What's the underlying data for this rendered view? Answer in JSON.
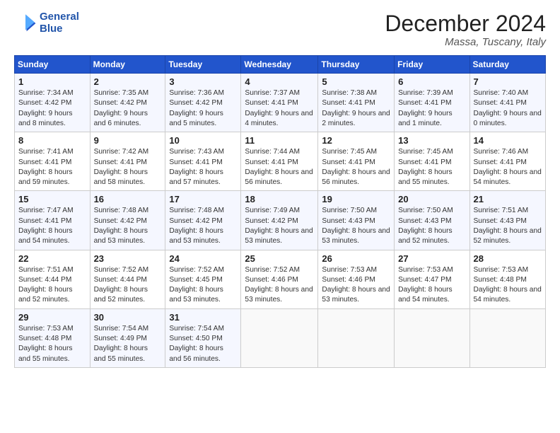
{
  "header": {
    "logo_line1": "General",
    "logo_line2": "Blue",
    "month": "December 2024",
    "location": "Massa, Tuscany, Italy"
  },
  "weekdays": [
    "Sunday",
    "Monday",
    "Tuesday",
    "Wednesday",
    "Thursday",
    "Friday",
    "Saturday"
  ],
  "weeks": [
    [
      {
        "day": "1",
        "sunrise": "Sunrise: 7:34 AM",
        "sunset": "Sunset: 4:42 PM",
        "daylight": "Daylight: 9 hours and 8 minutes."
      },
      {
        "day": "2",
        "sunrise": "Sunrise: 7:35 AM",
        "sunset": "Sunset: 4:42 PM",
        "daylight": "Daylight: 9 hours and 6 minutes."
      },
      {
        "day": "3",
        "sunrise": "Sunrise: 7:36 AM",
        "sunset": "Sunset: 4:42 PM",
        "daylight": "Daylight: 9 hours and 5 minutes."
      },
      {
        "day": "4",
        "sunrise": "Sunrise: 7:37 AM",
        "sunset": "Sunset: 4:41 PM",
        "daylight": "Daylight: 9 hours and 4 minutes."
      },
      {
        "day": "5",
        "sunrise": "Sunrise: 7:38 AM",
        "sunset": "Sunset: 4:41 PM",
        "daylight": "Daylight: 9 hours and 2 minutes."
      },
      {
        "day": "6",
        "sunrise": "Sunrise: 7:39 AM",
        "sunset": "Sunset: 4:41 PM",
        "daylight": "Daylight: 9 hours and 1 minute."
      },
      {
        "day": "7",
        "sunrise": "Sunrise: 7:40 AM",
        "sunset": "Sunset: 4:41 PM",
        "daylight": "Daylight: 9 hours and 0 minutes."
      }
    ],
    [
      {
        "day": "8",
        "sunrise": "Sunrise: 7:41 AM",
        "sunset": "Sunset: 4:41 PM",
        "daylight": "Daylight: 8 hours and 59 minutes."
      },
      {
        "day": "9",
        "sunrise": "Sunrise: 7:42 AM",
        "sunset": "Sunset: 4:41 PM",
        "daylight": "Daylight: 8 hours and 58 minutes."
      },
      {
        "day": "10",
        "sunrise": "Sunrise: 7:43 AM",
        "sunset": "Sunset: 4:41 PM",
        "daylight": "Daylight: 8 hours and 57 minutes."
      },
      {
        "day": "11",
        "sunrise": "Sunrise: 7:44 AM",
        "sunset": "Sunset: 4:41 PM",
        "daylight": "Daylight: 8 hours and 56 minutes."
      },
      {
        "day": "12",
        "sunrise": "Sunrise: 7:45 AM",
        "sunset": "Sunset: 4:41 PM",
        "daylight": "Daylight: 8 hours and 56 minutes."
      },
      {
        "day": "13",
        "sunrise": "Sunrise: 7:45 AM",
        "sunset": "Sunset: 4:41 PM",
        "daylight": "Daylight: 8 hours and 55 minutes."
      },
      {
        "day": "14",
        "sunrise": "Sunrise: 7:46 AM",
        "sunset": "Sunset: 4:41 PM",
        "daylight": "Daylight: 8 hours and 54 minutes."
      }
    ],
    [
      {
        "day": "15",
        "sunrise": "Sunrise: 7:47 AM",
        "sunset": "Sunset: 4:41 PM",
        "daylight": "Daylight: 8 hours and 54 minutes."
      },
      {
        "day": "16",
        "sunrise": "Sunrise: 7:48 AM",
        "sunset": "Sunset: 4:42 PM",
        "daylight": "Daylight: 8 hours and 53 minutes."
      },
      {
        "day": "17",
        "sunrise": "Sunrise: 7:48 AM",
        "sunset": "Sunset: 4:42 PM",
        "daylight": "Daylight: 8 hours and 53 minutes."
      },
      {
        "day": "18",
        "sunrise": "Sunrise: 7:49 AM",
        "sunset": "Sunset: 4:42 PM",
        "daylight": "Daylight: 8 hours and 53 minutes."
      },
      {
        "day": "19",
        "sunrise": "Sunrise: 7:50 AM",
        "sunset": "Sunset: 4:43 PM",
        "daylight": "Daylight: 8 hours and 53 minutes."
      },
      {
        "day": "20",
        "sunrise": "Sunrise: 7:50 AM",
        "sunset": "Sunset: 4:43 PM",
        "daylight": "Daylight: 8 hours and 52 minutes."
      },
      {
        "day": "21",
        "sunrise": "Sunrise: 7:51 AM",
        "sunset": "Sunset: 4:43 PM",
        "daylight": "Daylight: 8 hours and 52 minutes."
      }
    ],
    [
      {
        "day": "22",
        "sunrise": "Sunrise: 7:51 AM",
        "sunset": "Sunset: 4:44 PM",
        "daylight": "Daylight: 8 hours and 52 minutes."
      },
      {
        "day": "23",
        "sunrise": "Sunrise: 7:52 AM",
        "sunset": "Sunset: 4:44 PM",
        "daylight": "Daylight: 8 hours and 52 minutes."
      },
      {
        "day": "24",
        "sunrise": "Sunrise: 7:52 AM",
        "sunset": "Sunset: 4:45 PM",
        "daylight": "Daylight: 8 hours and 53 minutes."
      },
      {
        "day": "25",
        "sunrise": "Sunrise: 7:52 AM",
        "sunset": "Sunset: 4:46 PM",
        "daylight": "Daylight: 8 hours and 53 minutes."
      },
      {
        "day": "26",
        "sunrise": "Sunrise: 7:53 AM",
        "sunset": "Sunset: 4:46 PM",
        "daylight": "Daylight: 8 hours and 53 minutes."
      },
      {
        "day": "27",
        "sunrise": "Sunrise: 7:53 AM",
        "sunset": "Sunset: 4:47 PM",
        "daylight": "Daylight: 8 hours and 54 minutes."
      },
      {
        "day": "28",
        "sunrise": "Sunrise: 7:53 AM",
        "sunset": "Sunset: 4:48 PM",
        "daylight": "Daylight: 8 hours and 54 minutes."
      }
    ],
    [
      {
        "day": "29",
        "sunrise": "Sunrise: 7:53 AM",
        "sunset": "Sunset: 4:48 PM",
        "daylight": "Daylight: 8 hours and 55 minutes."
      },
      {
        "day": "30",
        "sunrise": "Sunrise: 7:54 AM",
        "sunset": "Sunset: 4:49 PM",
        "daylight": "Daylight: 8 hours and 55 minutes."
      },
      {
        "day": "31",
        "sunrise": "Sunrise: 7:54 AM",
        "sunset": "Sunset: 4:50 PM",
        "daylight": "Daylight: 8 hours and 56 minutes."
      },
      null,
      null,
      null,
      null
    ]
  ]
}
